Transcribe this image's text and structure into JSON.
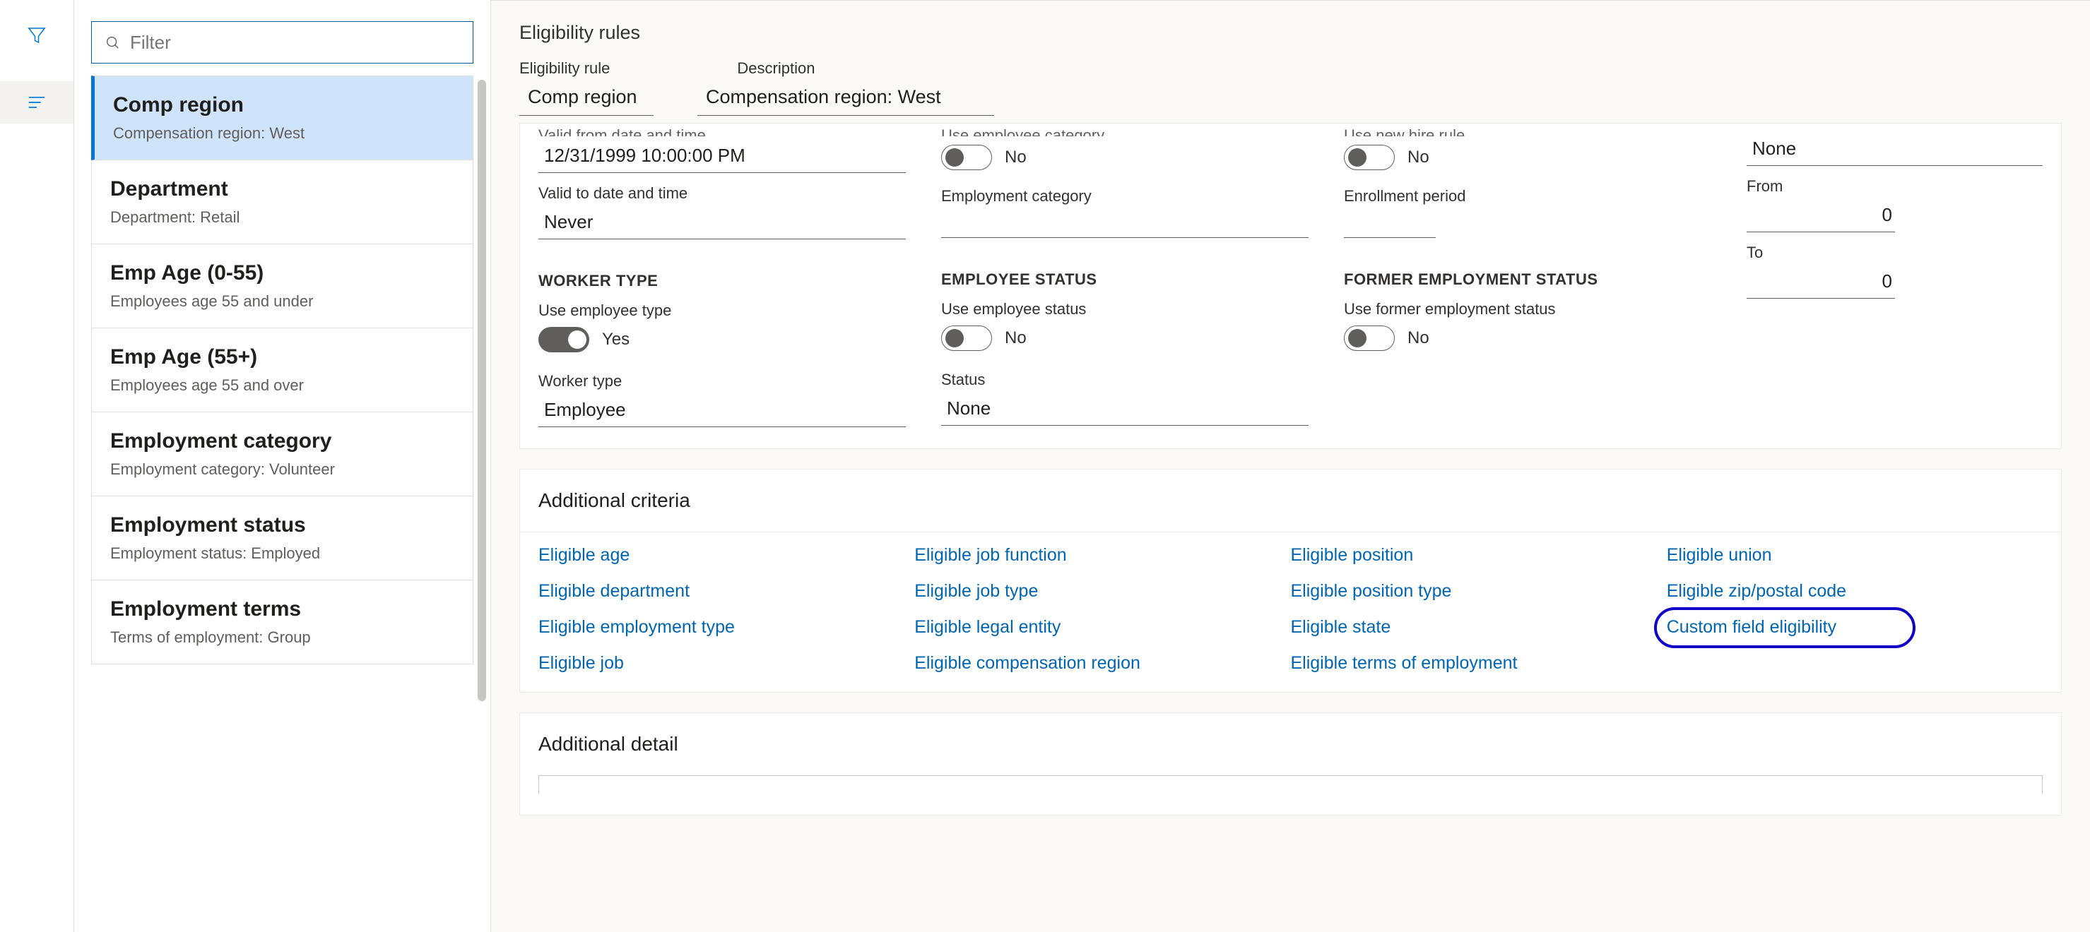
{
  "filter": {
    "placeholder": "Filter"
  },
  "sidebar": {
    "items": [
      {
        "title": "Comp region",
        "sub": "Compensation region:  West",
        "selected": true
      },
      {
        "title": "Department",
        "sub": "Department:  Retail"
      },
      {
        "title": "Emp Age (0-55)",
        "sub": "Employees age 55 and under"
      },
      {
        "title": "Emp Age (55+)",
        "sub": "Employees age 55 and over"
      },
      {
        "title": "Employment category",
        "sub": "Employment category:  Volunteer"
      },
      {
        "title": "Employment status",
        "sub": "Employment status: Employed"
      },
      {
        "title": "Employment terms",
        "sub": "Terms of employment: Group"
      }
    ]
  },
  "header": {
    "page_title": "Eligibility rules",
    "col1": "Eligibility rule",
    "col2": "Description",
    "val1": "Comp region",
    "val2": "Compensation region:  West"
  },
  "form": {
    "c1": {
      "cut": "Valid from date and time",
      "v1": "12/31/1999 10:00:00 PM",
      "l2": "Valid to date and time",
      "v2": "Never",
      "sec": "WORKER TYPE",
      "l3": "Use employee type",
      "t3": "Yes",
      "l4": "Worker type",
      "v4": "Employee"
    },
    "c2": {
      "cut": "Use employee category",
      "t1": "No",
      "l2": "Employment category",
      "v2": "",
      "sec": "EMPLOYEE STATUS",
      "l3": "Use employee status",
      "t3": "No",
      "l4": "Status",
      "v4": "None"
    },
    "c3": {
      "cut": "Use new hire rule",
      "t1": "No",
      "l2": "Enrollment period",
      "v2": "",
      "sec": "FORMER EMPLOYMENT STATUS",
      "l3": "Use former employment status",
      "t3": "No"
    },
    "c4": {
      "v1": "None",
      "l2": "From",
      "v2": "0",
      "l3": "To",
      "v3": "0"
    }
  },
  "additional_criteria": {
    "title": "Additional criteria",
    "links": {
      "r1c1": "Eligible age",
      "r1c2": "Eligible job function",
      "r1c3": "Eligible position",
      "r1c4": "Eligible union",
      "r2c1": "Eligible department",
      "r2c2": "Eligible job type",
      "r2c3": "Eligible position type",
      "r2c4": "Eligible zip/postal code",
      "r3c1": "Eligible employment type",
      "r3c2": "Eligible legal entity",
      "r3c3": "Eligible state",
      "r3c4": "Custom field eligibility",
      "r4c1": "Eligible job",
      "r4c2": "Eligible compensation region",
      "r4c3": "Eligible terms of employment"
    }
  },
  "additional_detail": {
    "title": "Additional detail"
  }
}
